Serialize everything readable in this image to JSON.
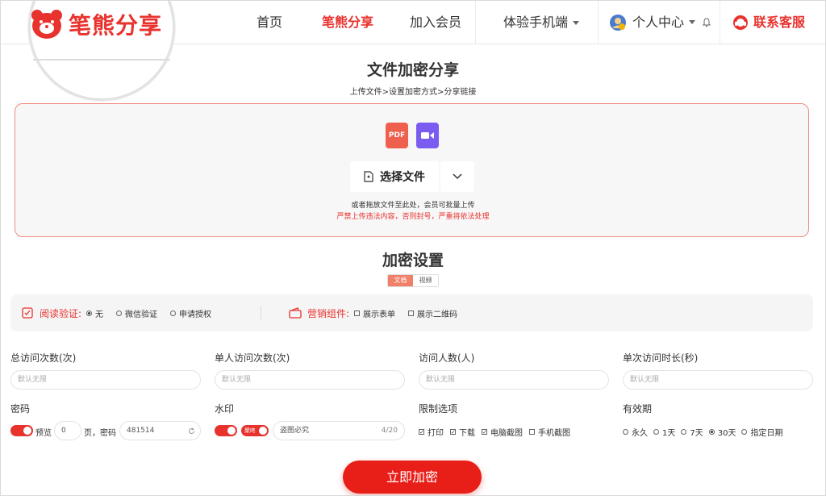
{
  "brand": {
    "name": "笔熊分享",
    "accent": "#e8322e"
  },
  "nav": {
    "home": "首页",
    "share": "笔熊分享",
    "join": "加入会员",
    "mobile": "体验手机端",
    "personal": "个人中心",
    "service": "联系客服"
  },
  "upload": {
    "title": "文件加密分享",
    "steps": "上传文件>设置加密方式>分享链接",
    "pdf_label": "PDF",
    "choose_label": "选择文件",
    "hint": "或者拖放文件至此处，会员可批量上传",
    "warning": "严禁上传违法内容，否则封号，严重将依法处理"
  },
  "settings": {
    "title": "加密设置",
    "tabs": [
      "文档",
      "视频"
    ],
    "read_verify": {
      "label": "阅读验证:",
      "options": [
        "无",
        "微信验证",
        "申请授权"
      ]
    },
    "marketing": {
      "label": "营销组件:",
      "options": [
        "展示表单",
        "展示二维码"
      ]
    }
  },
  "fields": {
    "total_visits": {
      "label": "总访问次数(次)",
      "placeholder": "默认无限"
    },
    "single_visits": {
      "label": "单人访问次数(次)",
      "placeholder": "默认无限"
    },
    "visitors": {
      "label": "访问人数(人)",
      "placeholder": "默认无限"
    },
    "duration": {
      "label": "单次访问时长(秒)",
      "placeholder": "默认无限"
    },
    "password": {
      "label": "密码",
      "preview": "预览",
      "pages": "0",
      "pages_suffix": "页，密码",
      "value": "481514"
    },
    "watermark": {
      "label": "水印",
      "badge": "聚咚",
      "value": "盗图必究",
      "count": "4/20"
    },
    "restrict": {
      "label": "限制选项",
      "options": [
        "打印",
        "下载",
        "电脑截图",
        "手机截图"
      ]
    },
    "validity": {
      "label": "有效期",
      "options": [
        "永久",
        "1天",
        "7天",
        "30天",
        "指定日期"
      ]
    }
  },
  "submit_label": "立即加密"
}
